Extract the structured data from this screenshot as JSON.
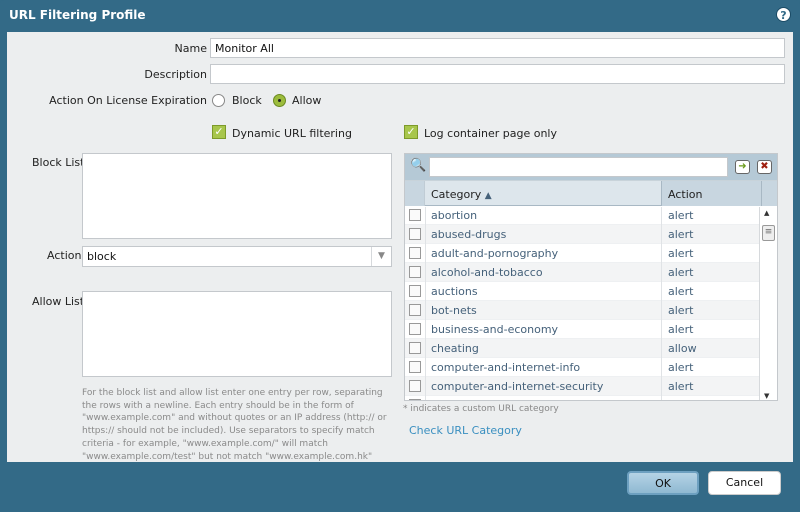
{
  "dialog": {
    "title": "URL Filtering Profile",
    "help_icon": "help-icon"
  },
  "form": {
    "name_label": "Name",
    "name_value": "Monitor All",
    "description_label": "Description",
    "description_value": "",
    "license_label": "Action On License Expiration",
    "license_options": [
      {
        "label": "Block",
        "selected": false
      },
      {
        "label": "Allow",
        "selected": true
      }
    ],
    "dynamic_label": "Dynamic URL filtering",
    "dynamic_checked": true,
    "log_container_label": "Log container page only",
    "log_container_checked": true,
    "block_list_label": "Block List",
    "block_list_value": "",
    "action_label": "Action",
    "action_value": "block",
    "allow_list_label": "Allow List",
    "allow_list_value": "",
    "help_text": "For the block list and allow list enter one entry per row, separating the rows with a newline. Each entry should be in the form of \"www.example.com\" and without quotes or an IP address (http:// or https:// should not be included). Use separators to specify match criteria - for example, \"www.example.com/\" will match \"www.example.com/test\" but not match \"www.example.com.hk\""
  },
  "categories": {
    "search_value": "",
    "columns": [
      "Category",
      "Action"
    ],
    "sort": "ascending",
    "rows": [
      {
        "category": "abortion",
        "action": "alert"
      },
      {
        "category": "abused-drugs",
        "action": "alert"
      },
      {
        "category": "adult-and-pornography",
        "action": "alert"
      },
      {
        "category": "alcohol-and-tobacco",
        "action": "alert"
      },
      {
        "category": "auctions",
        "action": "alert"
      },
      {
        "category": "bot-nets",
        "action": "alert"
      },
      {
        "category": "business-and-economy",
        "action": "alert"
      },
      {
        "category": "cheating",
        "action": "allow"
      },
      {
        "category": "computer-and-internet-info",
        "action": "alert"
      },
      {
        "category": "computer-and-internet-security",
        "action": "alert"
      }
    ],
    "footnote": "* indicates a custom URL category",
    "check_link": "Check URL Category"
  },
  "buttons": {
    "ok": "OK",
    "cancel": "Cancel"
  },
  "colors": {
    "titlebar": "#336a87",
    "check": "#a8c64c",
    "link": "#3a8fc0"
  }
}
